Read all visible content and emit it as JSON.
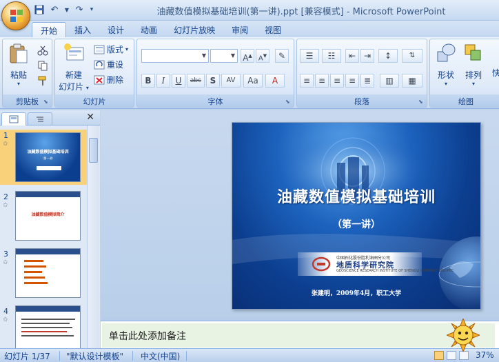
{
  "window": {
    "title": "油藏数值模拟基础培训(第一讲).ppt [兼容模式] - Microsoft PowerPoint"
  },
  "quick_access": {
    "save_icon": "save-icon",
    "undo_icon": "undo-icon",
    "redo_icon": "redo-icon",
    "customize_icon": "chevron-down-icon"
  },
  "tabs": [
    {
      "label": "开始",
      "active": true
    },
    {
      "label": "插入"
    },
    {
      "label": "设计"
    },
    {
      "label": "动画"
    },
    {
      "label": "幻灯片放映"
    },
    {
      "label": "审阅"
    },
    {
      "label": "视图"
    }
  ],
  "ribbon": {
    "clipboard": {
      "label": "剪贴板",
      "paste": "粘贴"
    },
    "slides": {
      "label": "幻灯片",
      "new_slide_1": "新建",
      "new_slide_2": "幻灯片",
      "layout": "版式",
      "reset": "重设",
      "delete": "删除"
    },
    "font": {
      "label": "字体",
      "bold": "B",
      "italic": "I",
      "underline": "U",
      "strike": "abc",
      "shadow": "S",
      "spacing": "AV",
      "case": "Aa",
      "color": "A"
    },
    "paragraph": {
      "label": "段落"
    },
    "drawing": {
      "label": "绘图",
      "shapes": "形状",
      "arrange": "排列",
      "quick_styles": "快"
    }
  },
  "slide_pane": {
    "thumbnails": [
      {
        "number": "1",
        "title": "油藏数值模拟基础培训",
        "sub": "（第一讲）"
      },
      {
        "number": "2",
        "title": "油藏数值模拟简介"
      },
      {
        "number": "3"
      },
      {
        "number": "4"
      }
    ]
  },
  "slide": {
    "title": "油藏数值模拟基础培训",
    "subtitle": "（第一讲）",
    "logo_line1": "中国石化股份胜利油田分公司",
    "logo_line2": "地质科学研究院",
    "logo_line3": "GEOSCIENCE RESEARCH INSTITUTE OF SHENGLI COMPANY SINOPEC",
    "author": "张建明，2009年4月，职工大学"
  },
  "notes": {
    "placeholder": "单击此处添加备注"
  },
  "status": {
    "slide_info": "幻灯片 1/37",
    "theme": "\"默认设计模板\"",
    "language": "中文(中国)",
    "zoom": "37%"
  }
}
